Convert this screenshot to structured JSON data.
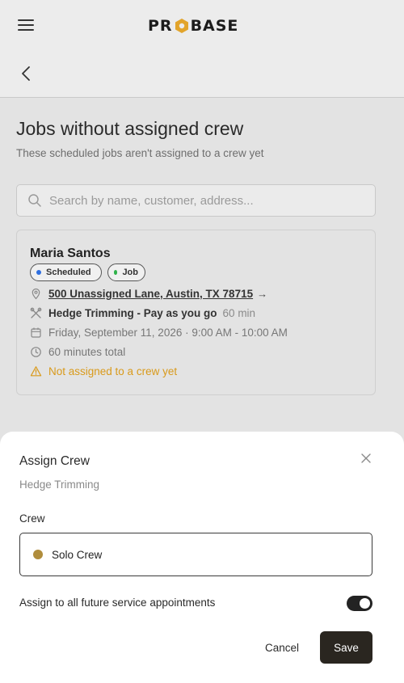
{
  "header": {
    "logo_left": "PR",
    "logo_right": "BASE",
    "menu_icon": "hamburger-menu-icon",
    "back_icon": "chevron-left-icon"
  },
  "page": {
    "title": "Jobs without assigned crew",
    "subtitle": "These scheduled jobs aren't assigned to a crew yet"
  },
  "search": {
    "placeholder": "Search by name, customer, address...",
    "value": ""
  },
  "job": {
    "customer": "Maria Santos",
    "badges": [
      {
        "label": "Scheduled",
        "color": "#2f6fe0"
      },
      {
        "label": "Job",
        "color": "#2fb24a"
      }
    ],
    "address": "500 Unassigned Lane, Austin, TX 78715",
    "address_arrow": "→",
    "service": "Hedge Trimming - Pay as you go",
    "service_duration": "60 min",
    "schedule": "Friday, September 11, 2026 · 9:00 AM - 10:00 AM",
    "total": "60 minutes total",
    "warning": "Not assigned to a crew yet"
  },
  "sheet": {
    "title": "Assign Crew",
    "subtitle": "Hedge Trimming",
    "crew_label": "Crew",
    "crew_selected": "Solo Crew",
    "crew_color": "#b08d3c",
    "future_label": "Assign to all future service appointments",
    "future_enabled": true,
    "cancel_label": "Cancel",
    "save_label": "Save"
  },
  "colors": {
    "accent": "#2a2620",
    "logo_hex": "#e2a42b",
    "warning": "#d99a1b"
  }
}
